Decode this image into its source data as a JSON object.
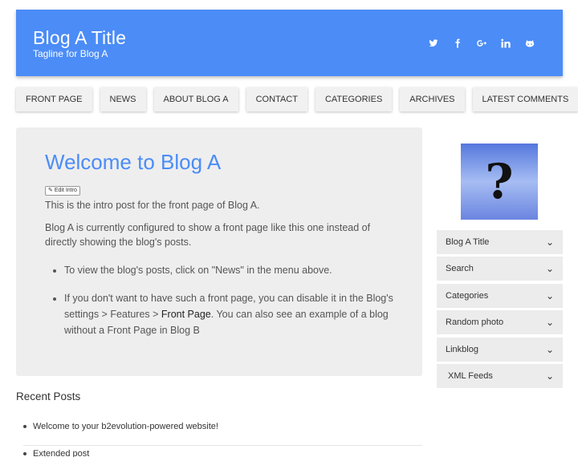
{
  "header": {
    "title": "Blog A Title",
    "tagline": "Tagline for Blog A",
    "social": [
      "twitter-icon",
      "facebook-icon",
      "google-plus-icon",
      "linkedin-icon",
      "github-icon"
    ]
  },
  "menu": [
    {
      "label": "FRONT PAGE"
    },
    {
      "label": "NEWS"
    },
    {
      "label": "ABOUT BLOG A"
    },
    {
      "label": "CONTACT"
    },
    {
      "label": "CATEGORIES"
    },
    {
      "label": "ARCHIVES"
    },
    {
      "label": "LATEST COMMENTS"
    }
  ],
  "intro": {
    "title": "Welcome to Blog A",
    "edit_label": "Edit Intro",
    "p1": "This is the intro post for the front page of Blog A.",
    "p2": "Blog A is currently configured to show a front page like this one instead of directly showing the blog's posts.",
    "bullet1": "To view the blog's posts, click on \"News\" in the menu above.",
    "bullet2_a": "If you don't want to have such a front page, you can disable it in the Blog's settings > Features > ",
    "bullet2_link": "Front Page",
    "bullet2_b": ". You can also see an example of a blog without a Front Page in Blog B"
  },
  "recent_posts": {
    "title": "Recent Posts",
    "items": [
      "Welcome to your b2evolution-powered website!",
      "Extended post"
    ]
  },
  "sidebar": {
    "widgets": [
      {
        "label": "Blog A Title"
      },
      {
        "label": "Search"
      },
      {
        "label": "Categories"
      },
      {
        "label": "Random photo"
      },
      {
        "label": "Linkblog"
      },
      {
        "label": "XML Feeds"
      }
    ]
  }
}
